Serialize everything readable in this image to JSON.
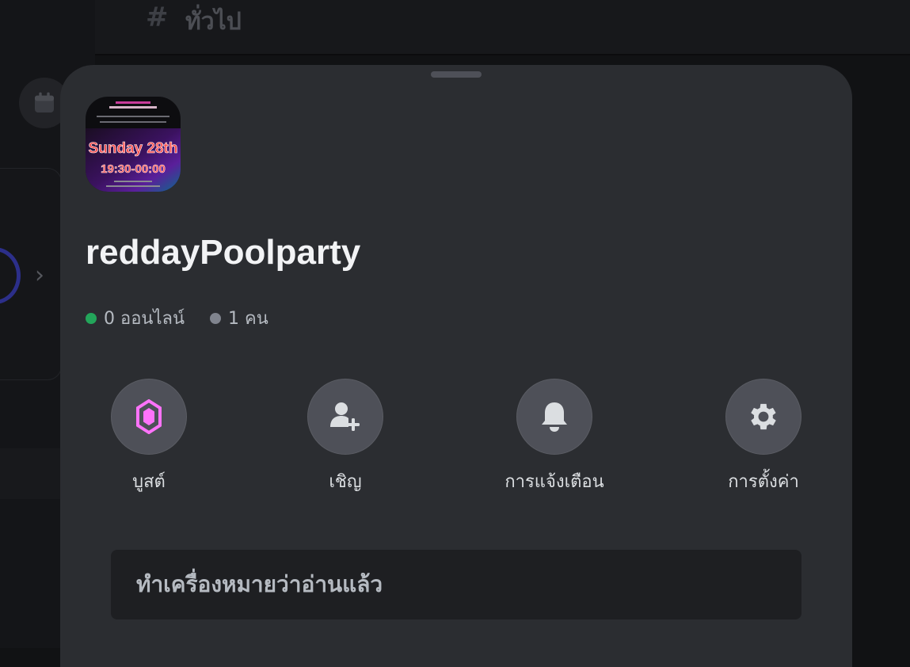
{
  "background": {
    "channel_hash": "#",
    "channel_name": "ทั่วไป"
  },
  "server": {
    "icon_text_line1": "Sunday 28th",
    "icon_text_line2": "19:30-00:00",
    "name": "reddayPoolparty",
    "online_count": "0 ออนไลน์",
    "member_count": "1 คน",
    "online_color": "#23a55a",
    "member_color": "#80848e"
  },
  "actions": [
    {
      "label": "บูสต์",
      "icon": "boost-gem-icon"
    },
    {
      "label": "เชิญ",
      "icon": "add-user-icon"
    },
    {
      "label": "การแจ้งเตือน",
      "icon": "bell-icon"
    },
    {
      "label": "การตั้งค่า",
      "icon": "gear-icon"
    }
  ],
  "mark_read_label": "ทำเครื่องหมายว่าอ่านแล้ว",
  "colors": {
    "sheet": "#2b2d31",
    "action_circle": "#4e5058",
    "boost_pink": "#ff73fa"
  }
}
